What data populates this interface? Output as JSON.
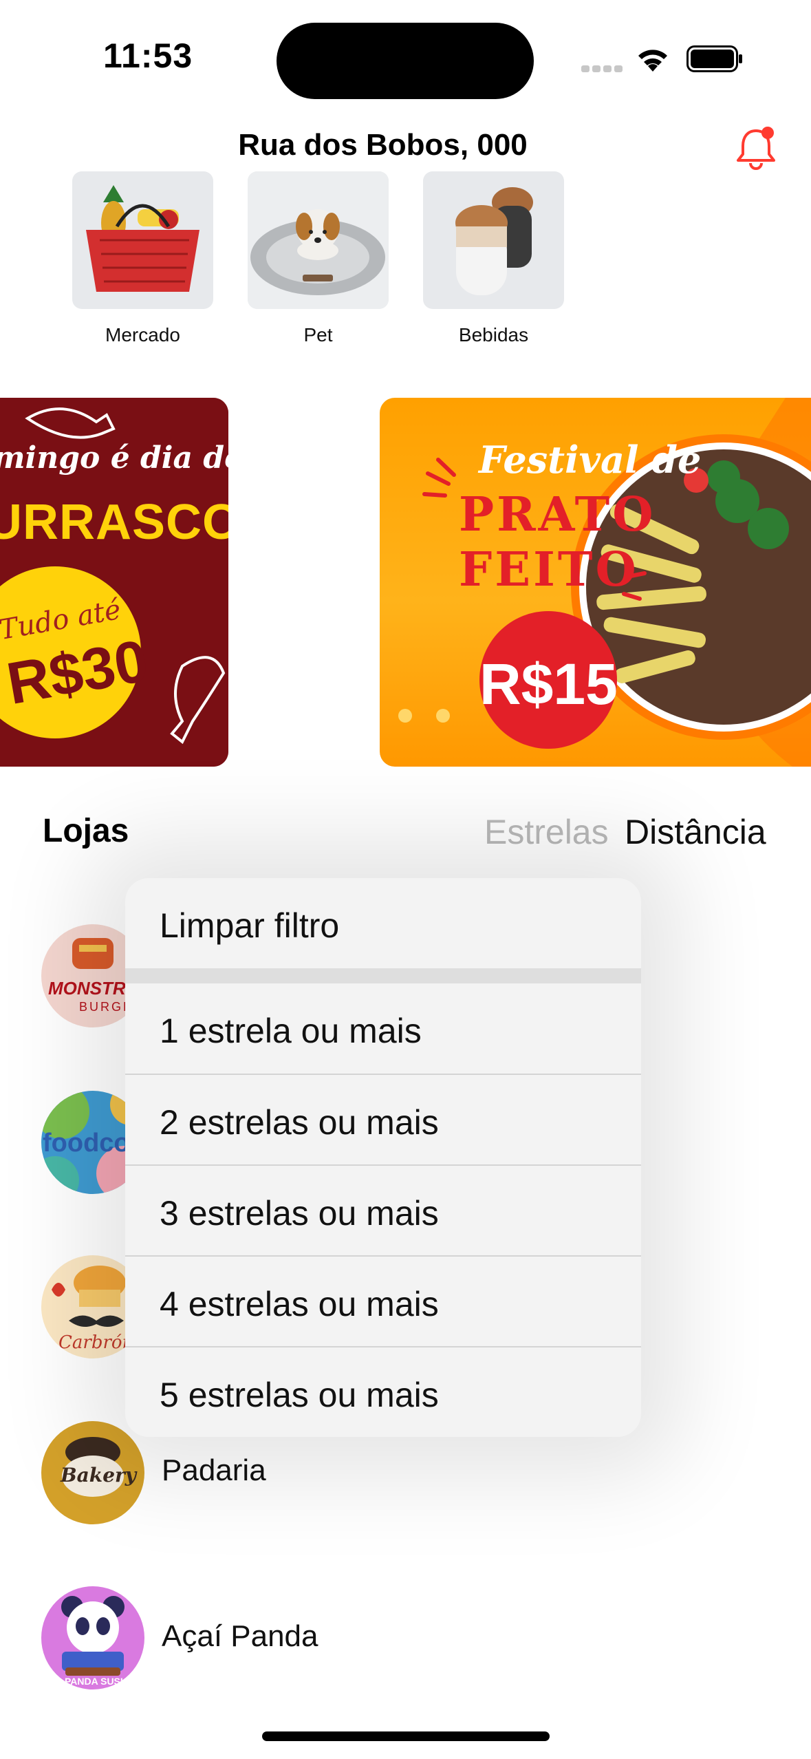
{
  "status_bar": {
    "time": "11:53"
  },
  "header": {
    "address": "Rua dos Bobos, 000"
  },
  "categories": [
    {
      "label": "Mercado",
      "icon": "shopping-basket-image"
    },
    {
      "label": "Pet",
      "icon": "dog-bed-image"
    },
    {
      "label": "Bebidas",
      "icon": "coffee-drinks-image"
    }
  ],
  "banners": [
    {
      "line1": "mingo é dia de",
      "line2": "URRASCO",
      "badge_line1": "Tudo até",
      "badge_line2": "R$30"
    },
    {
      "line1": "Festival de",
      "line2": "PRATO",
      "line3": "FEITO",
      "badge": "R$15"
    }
  ],
  "stores_section": {
    "title": "Lojas",
    "sort_stars": "Estrelas",
    "sort_distance": "Distância"
  },
  "store_logos": [
    {
      "logo_text": "MONSTRO",
      "sub": "BURGER"
    },
    {
      "logo_text": "foodcou"
    },
    {
      "logo_text": "Carbrón"
    }
  ],
  "stores": [
    {
      "name": "Padaria",
      "logo_text": "Bakery"
    },
    {
      "name": "Açaí Panda",
      "logo_text": "PANDA SUSHI"
    }
  ],
  "filter_menu": {
    "clear": "Limpar filtro",
    "options": [
      "1 estrela ou mais",
      "2 estrelas ou mais",
      "3 estrelas ou mais",
      "4 estrelas ou mais",
      "5 estrelas ou mais"
    ]
  },
  "colors": {
    "notification": "#ff3b30",
    "banner_red": "#7a0f14",
    "banner_orange": "#ffa000"
  }
}
